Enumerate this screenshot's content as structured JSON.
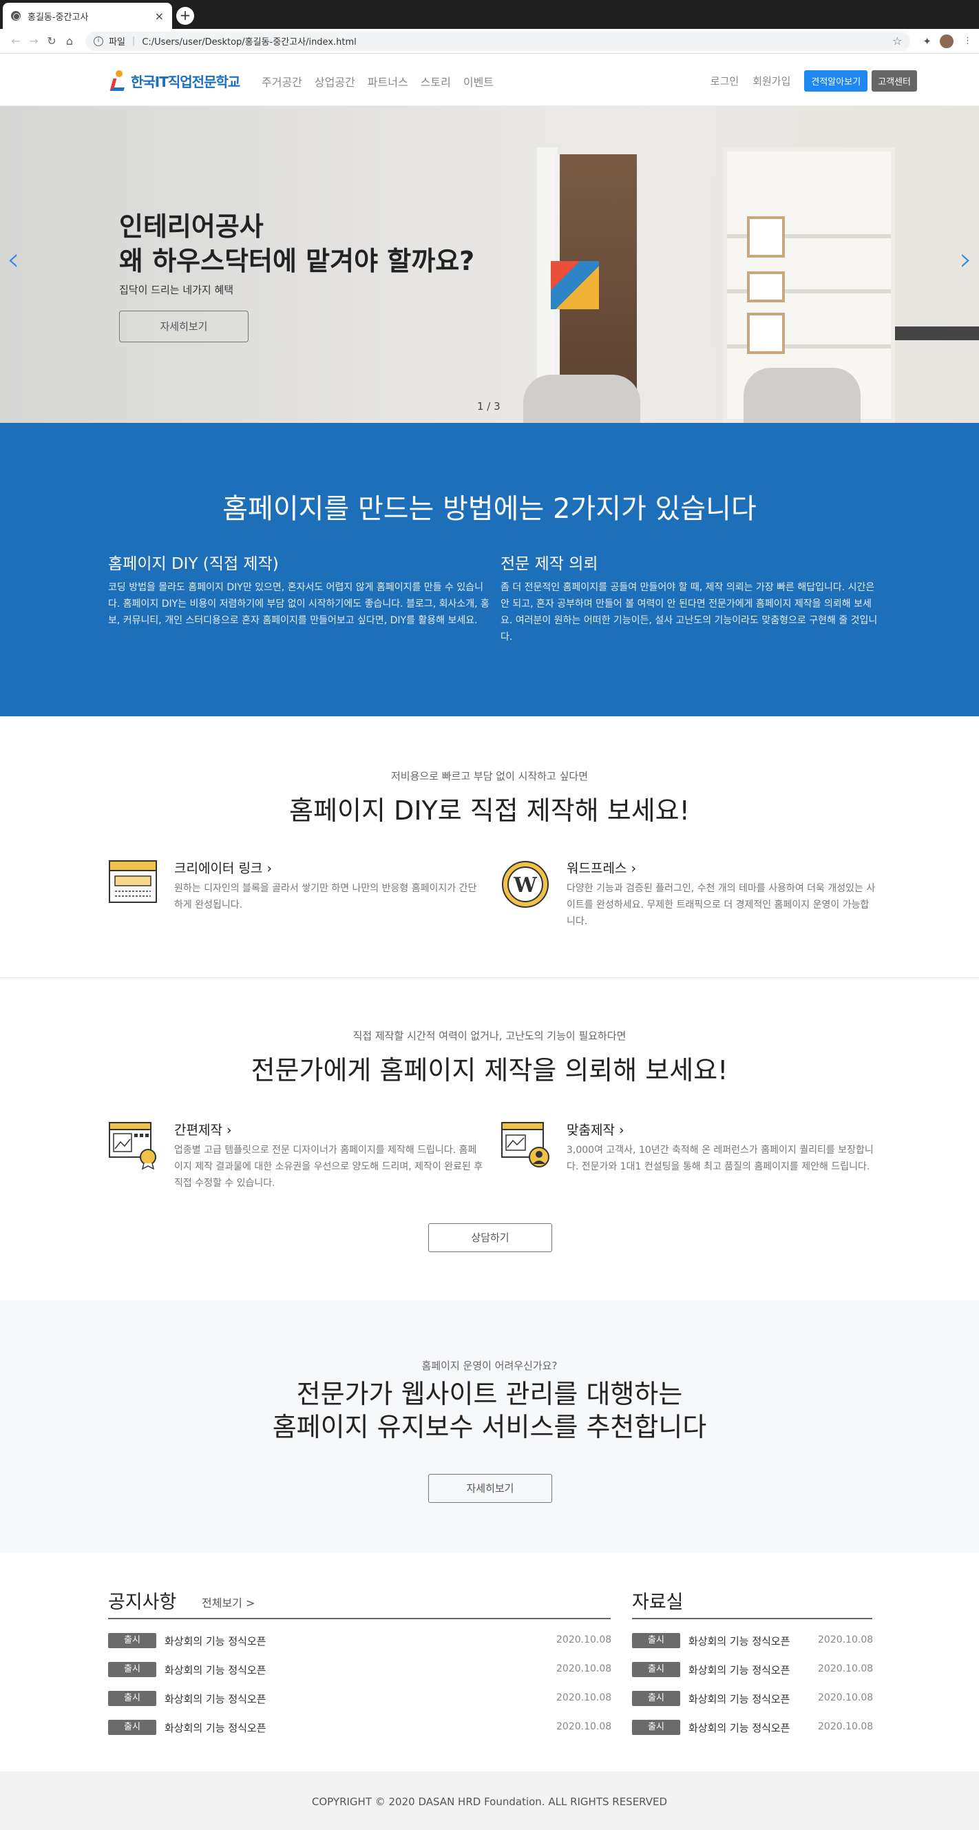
{
  "browser": {
    "tab_title": "홍길동-중간고사",
    "url_prefix": "파일",
    "url": "C:/Users/user/Desktop/홍길동-중간고사/index.html"
  },
  "header": {
    "logo_text": "한국IT직업전문학교",
    "nav": [
      "주거공간",
      "상업공간",
      "파트너스",
      "스토리",
      "이벤트"
    ],
    "login": "로그인",
    "signup": "회원가입",
    "estimate_button": "견적알아보기",
    "cs_button": "고객센터"
  },
  "hero": {
    "title_line1": "인테리어공사",
    "title_line2": "왜 하우스닥터에 맡겨야 할까요?",
    "subtitle": "집닥이 드리는 네가지 혜택",
    "more_button": "자세히보기",
    "pager": "1 / 3"
  },
  "methods": {
    "title": "홈페이지를 만드는 방법에는 2가지가 있습니다",
    "diy_title": "홈페이지 DIY (직접 제작)",
    "diy_text": "코딩 방법을 몰라도 홈페이지 DIY만 있으면, 혼자서도 어렵지 않게 홈페이지를 만들 수 있습니다. 홈페이지 DIY는 비용이 저렴하기에 부담 없이 시작하기에도 좋습니다. 블로그, 회사소개, 홍보, 커뮤니티, 개인 스터디용으로 혼자 홈페이지를 만들어보고 싶다면, DIY를 활용해 보세요.",
    "pro_title": "전문 제작 의뢰",
    "pro_text": "좀 더 전문적인 홈페이지를 공들여 만들어야 할 때, 제작 의뢰는 가장 빠른 해답입니다. 시간은 안 되고, 혼자 공부하며 만들어 볼 여력이 안 된다면 전문가에게 홈페이지 제작을 의뢰해 보세요. 여러분이 원하는 어떠한 기능이든, 설사 고난도의 기능이라도 맞춤형으로 구현해 줄 것입니다."
  },
  "diy": {
    "pre": "저비용으로 빠르고 부담 없이 시작하고 싶다면",
    "title": "홈페이지 DIY로 직접 제작해 보세요!",
    "item1_title": "크리에이터 링크",
    "item1_text": "원하는 디자인의 블록을 골라서 쌓기만 하면 나만의 반응형 홈페이지가 간단하게 완성됩니다.",
    "item2_title": "워드프레스",
    "item2_text": "다양한 기능과 검증된 플러그인, 수천 개의 테마를 사용하여 더욱 개성있는 사이트를 완성하세요. 무제한 트래픽으로 더 경제적인 홈페이지 운영이 가능합니다."
  },
  "expert": {
    "pre": "직접 제작할 시간적 여력이 없거나, 고난도의 기능이 필요하다면",
    "title": "전문가에게 홈페이지 제작을 의뢰해 보세요!",
    "item1_title": "간편제작",
    "item1_text": "업종별 고급 템플릿으로 전문 디자이너가 홈페이지를 제작해 드립니다. 홈페이지 제작 결과물에 대한 소유권을 우선으로 양도해 드리며, 제작이 완료된 후 직접 수정할 수 있습니다.",
    "item2_title": "맞춤제작",
    "item2_text": "3,000여 고객사, 10년간 축적해 온 레퍼런스가 홈페이지 퀄리티를 보장합니다. 전문가와 1대1 컨설팅을 통해 최고 품질의 홈페이지를 제안해 드립니다.",
    "consult_button": "상담하기"
  },
  "maintenance": {
    "pre": "홈페이지 운영이 어려우신가요?",
    "title_line1": "전문가가 웹사이트 관리를 대행하는",
    "title_line2": "홈페이지 유지보수 서비스를 추천합니다",
    "more_button": "자세히보기"
  },
  "notice": {
    "title": "공지사항",
    "more": "전체보기 >",
    "rows": [
      {
        "badge": "출시",
        "text": "화상회의 기능 정식오픈",
        "date": "2020.10.08"
      },
      {
        "badge": "출시",
        "text": "화상회의 기능 정식오픈",
        "date": "2020.10.08"
      },
      {
        "badge": "출시",
        "text": "화상회의 기능 정식오픈",
        "date": "2020.10.08"
      },
      {
        "badge": "출시",
        "text": "화상회의 기능 정식오픈",
        "date": "2020.10.08"
      }
    ]
  },
  "archive": {
    "title": "자료실",
    "rows": [
      {
        "badge": "출시",
        "text": "화상회의 기능 정식오픈",
        "date": "2020.10.08"
      },
      {
        "badge": "출시",
        "text": "화상회의 기능 정식오픈",
        "date": "2020.10.08"
      },
      {
        "badge": "출시",
        "text": "화상회의 기능 정식오픈",
        "date": "2020.10.08"
      },
      {
        "badge": "출시",
        "text": "화상회의 기능 정식오픈",
        "date": "2020.10.08"
      }
    ]
  },
  "footer": {
    "copyright": "COPYRIGHT © 2020 DASAN HRD Foundation. ALL RIGHTS RESERVED"
  },
  "colors": {
    "primary_blue": "#1e6fba",
    "button_blue": "#1e88f0",
    "icon_gold": "#f0c24a"
  }
}
